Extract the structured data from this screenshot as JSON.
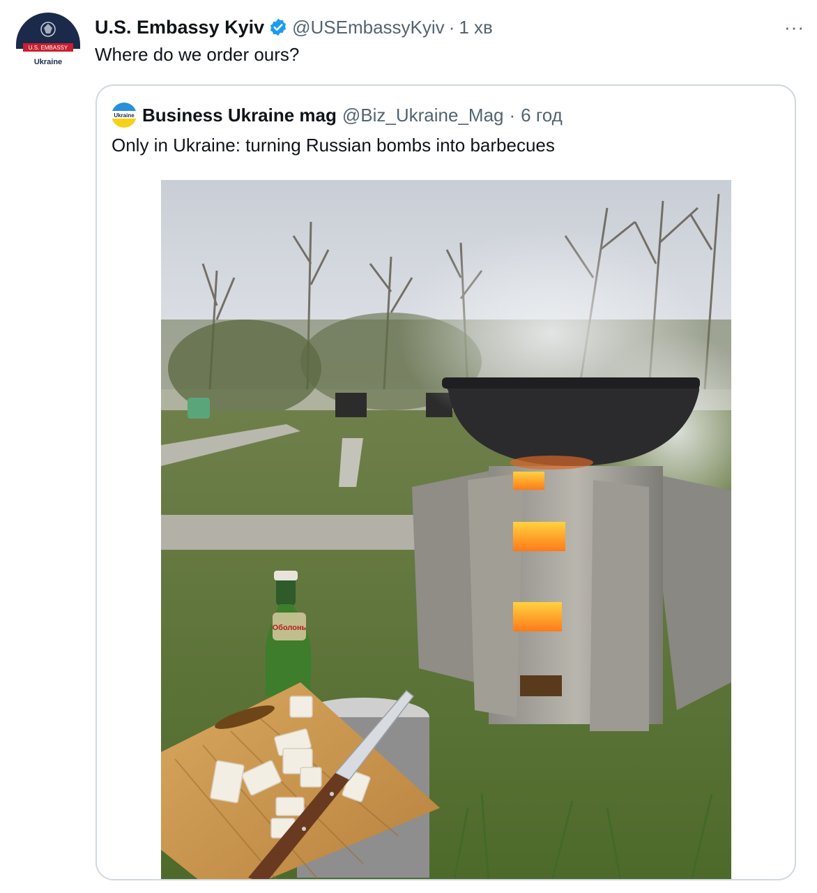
{
  "tweet": {
    "avatar_top_text": "U.S. EMBASSY",
    "avatar_bottom_text": "Ukraine",
    "author_name": "U.S. Embassy Kyiv",
    "handle": "@USEmbassyKyiv",
    "separator": "·",
    "time": "1 хв",
    "more_label": "···",
    "text": "Where do we order ours?",
    "icons": {
      "verified": "verified-badge-icon",
      "more": "more-options-icon"
    },
    "colors": {
      "verified": "#1d9bf0",
      "secondary_text": "#536471",
      "border": "#cfd9de"
    }
  },
  "quoted": {
    "avatar_text": "Ukraine",
    "author_name": "Business Ukraine mag",
    "handle": "@Biz_Ukraine_Mag",
    "separator": "·",
    "time": "6 год",
    "text": "Only in Ukraine: turning Russian bombs into barbecues",
    "media": {
      "description": "Photo: cauldron on a stove made from bomb fins, beer bottle, cutting board with salo and knife on grass",
      "bottle_label": "Оболонь"
    }
  }
}
